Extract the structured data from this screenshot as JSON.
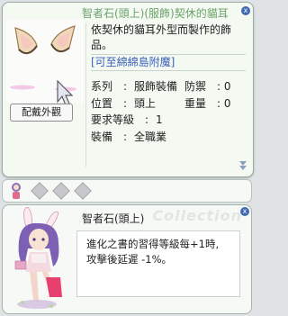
{
  "item_window": {
    "title": "智者石(頭上)(服飾)契休的貓耳",
    "close_label": "x",
    "description_line1": "依契休的貓耳外型而製作的飾",
    "description_line2": "品。",
    "link_text": "[可至綿綿島附魔]",
    "stats": {
      "type_label": "系列",
      "type_value": "服飾裝備",
      "defense_label": "防禦",
      "defense_value": "0",
      "location_label": "位置",
      "location_value": "頭上",
      "weight_label": "重量",
      "weight_value": "0",
      "level_label": "要求等級",
      "level_value": "1",
      "equip_label": "裝備",
      "equip_value": "全職業",
      "colon": ":"
    },
    "display_button": "配戴外觀"
  },
  "card_window": {
    "watermark": "Collection",
    "close_label": "x",
    "name": "智者石(頭上)",
    "effect_line1": "進化之書的習得等級每+1時,",
    "effect_line2": "攻擊後延遲 -1%。"
  }
}
